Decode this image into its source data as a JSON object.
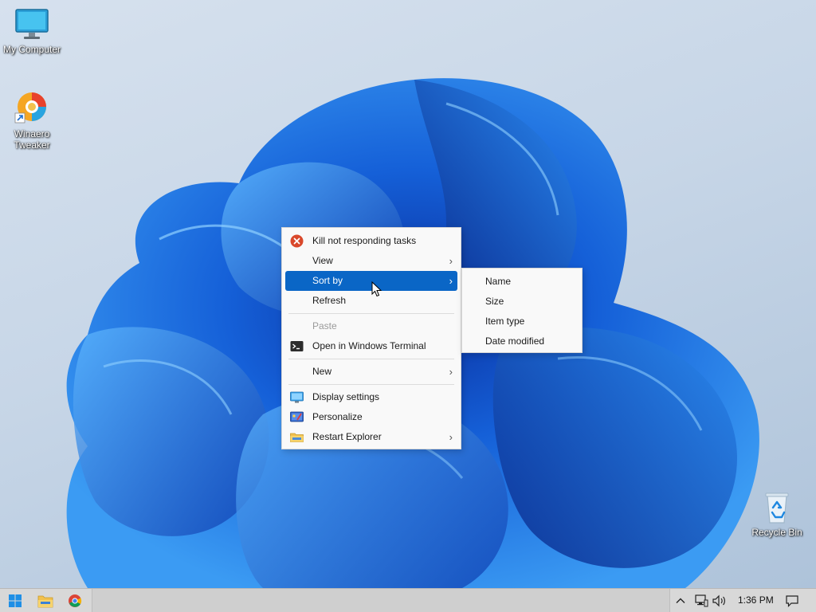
{
  "desktop": {
    "icons": [
      {
        "label": "My Computer",
        "icon": "monitor-icon"
      },
      {
        "label": "Winaero Tweaker",
        "icon": "winaero-tweaker-icon"
      },
      {
        "label": "Recycle Bin",
        "icon": "recycle-bin-icon"
      }
    ]
  },
  "context_menu": {
    "items": [
      {
        "label": "Kill not responding tasks",
        "icon": "stop-icon"
      },
      {
        "label": "View",
        "icon": "",
        "has_submenu": true
      },
      {
        "label": "Sort by",
        "icon": "",
        "has_submenu": true,
        "highlighted": true
      },
      {
        "label": "Refresh",
        "icon": ""
      },
      {
        "label": "Paste",
        "icon": "",
        "disabled": true
      },
      {
        "label": "Open in Windows Terminal",
        "icon": "terminal-icon"
      },
      {
        "label": "New",
        "icon": "",
        "has_submenu": true
      },
      {
        "label": "Display settings",
        "icon": "display-icon"
      },
      {
        "label": "Personalize",
        "icon": "personalize-icon"
      },
      {
        "label": "Restart Explorer",
        "icon": "folder-icon",
        "has_submenu": true
      }
    ],
    "chevron": "›"
  },
  "sort_submenu": {
    "items": [
      {
        "label": "Name"
      },
      {
        "label": "Size"
      },
      {
        "label": "Item type"
      },
      {
        "label": "Date modified"
      }
    ]
  },
  "taskbar": {
    "pinned": [
      "start-icon",
      "file-explorer-icon",
      "chrome-icon"
    ],
    "tray_icons": [
      "chevron-up-icon",
      "network-icon",
      "volume-icon",
      "notification-icon"
    ],
    "clock": "1:36 PM"
  },
  "colors": {
    "highlight": "#0a66c6",
    "menu_bg": "#f9f9f9",
    "taskbar_bg": "#cfcfcf"
  }
}
